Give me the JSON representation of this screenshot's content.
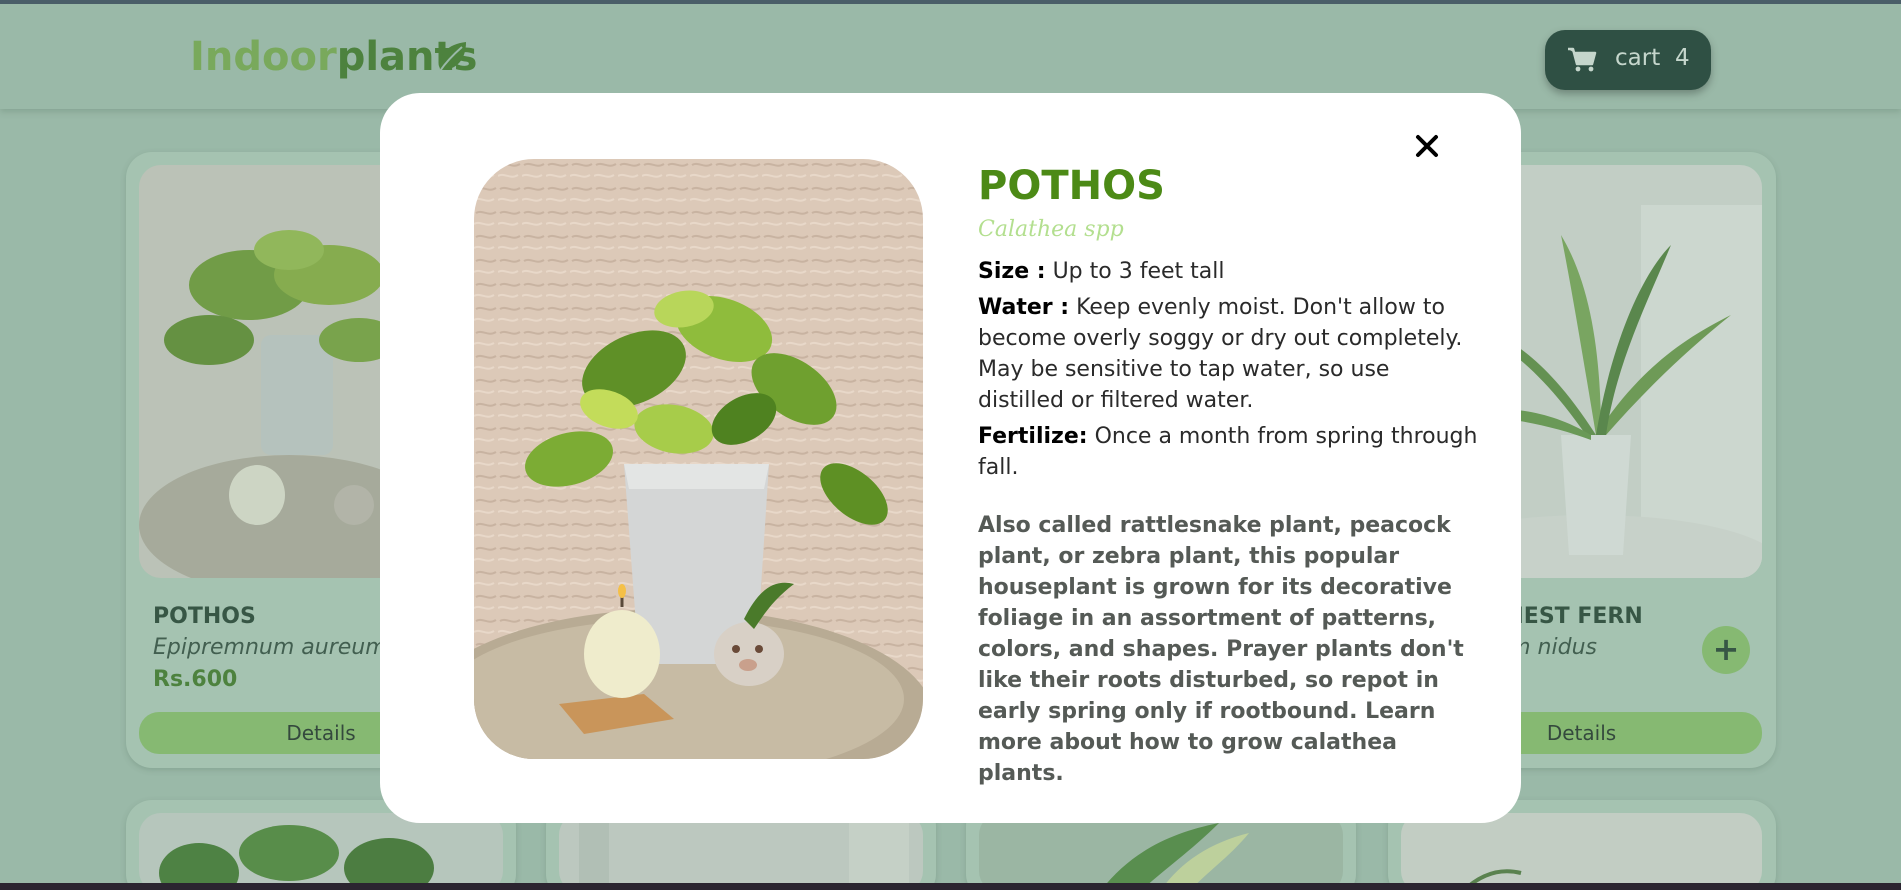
{
  "header": {
    "logo_part1": "Indoor",
    "logo_part2": "plants",
    "cart_label": "cart",
    "cart_count": "4"
  },
  "products": [
    {
      "name": "POTHOS",
      "scientific": "Epipremnum aureum",
      "price": "Rs.600",
      "details_label": "Details"
    },
    {
      "name": "BIRD'S NEST FERN",
      "scientific": "Asplenium nidus",
      "details_label": "Details",
      "add_label": "+"
    }
  ],
  "modal": {
    "title": "POTHOS",
    "scientific": "Calathea spp",
    "size_label": "Size :",
    "size_value": "Up to 3 feet tall",
    "water_label": "Water :",
    "water_value": "Keep evenly moist. Don't allow to become overly soggy or dry out completely. May be sensitive to tap water, so use distilled or filtered water.",
    "fertilize_label": "Fertilize:",
    "fertilize_value": "Once a month from spring through fall.",
    "description": "Also called rattlesnake plant, peacock plant, or zebra plant, this popular houseplant is grown for its decorative foliage in an assortment of patterns, colors, and shapes. Prayer plants don't like their roots disturbed, so repot in early spring only if rootbound. Learn more about how to grow calathea plants.",
    "close_icon": "close-icon"
  },
  "colors": {
    "page_bg": "#a8c6b4",
    "accent_green": "#4c8a16",
    "button_green": "#8cc76a",
    "cart_bg": "#14352a"
  }
}
